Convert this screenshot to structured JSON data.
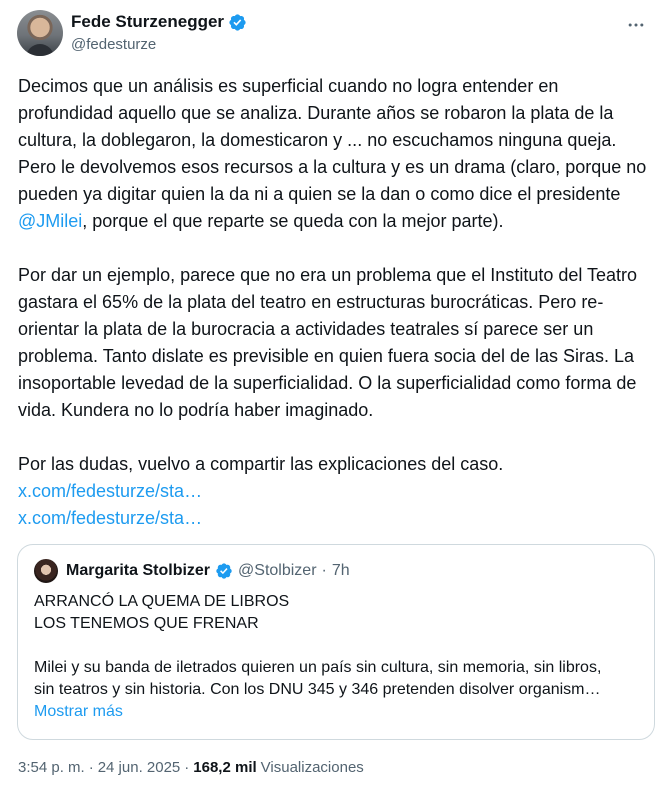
{
  "tweet": {
    "author": {
      "display_name": "Fede Sturzenegger",
      "handle": "@fedesturze"
    },
    "paragraphs": {
      "p1_before": "Decimos que un análisis es superficial cuando no logra entender en profundidad aquello que se analiza. Durante años se robaron la plata de la cultura, la doblegaron, la domesticaron y ... no escuchamos ninguna queja. Pero le devolvemos esos recursos a la cultura y es un drama (claro, porque no pueden ya digitar quien la da ni a quien se la dan o como dice el presidente ",
      "p1_mention": "@JMilei",
      "p1_after": ", porque el que reparte se queda con la mejor parte).",
      "p2": "Por dar un ejemplo, parece que no era un problema que el Instituto del Teatro gastara el 65% de la plata del teatro en estructuras burocráticas. Pero re-orientar la plata de la burocracia a actividades teatrales sí parece ser un problema. Tanto dislate es previsible en quien fuera socia del de las Siras. La insoportable levedad de la superficialidad. O la superficialidad como forma de vida. Kundera no lo podría haber imaginado.",
      "p3": "Por las dudas, vuelvo a compartir las explicaciones del caso."
    },
    "links": [
      "x.com/fedesturze/sta…",
      "x.com/fedesturze/sta…"
    ],
    "quoted": {
      "display_name": "Margarita Stolbizer",
      "handle": "@Stolbizer",
      "separator": "·",
      "time": "7h",
      "line1": "ARRANCÓ LA QUEMA DE LIBROS",
      "line2": "LOS TENEMOS QUE FRENAR",
      "body_line1": "Milei y su banda de iletrados quieren un país sin cultura, sin memoria, sin libros,",
      "body_line2": "sin teatros y sin historia. Con los DNU 345 y 346 pretenden disolver organism…",
      "show_more": "Mostrar más"
    },
    "meta": {
      "time": "3:54 p. m.",
      "sep1": "·",
      "date": "24 jun. 2025",
      "sep2": "·",
      "views_count": "168,2 mil",
      "views_label": "Visualizaciones"
    }
  },
  "colors": {
    "accent": "#1d9bf0",
    "text": "#0f1419",
    "secondary": "#536471",
    "border": "#cfd9de"
  },
  "icons": [
    "verified-badge-icon",
    "more-options-icon"
  ]
}
